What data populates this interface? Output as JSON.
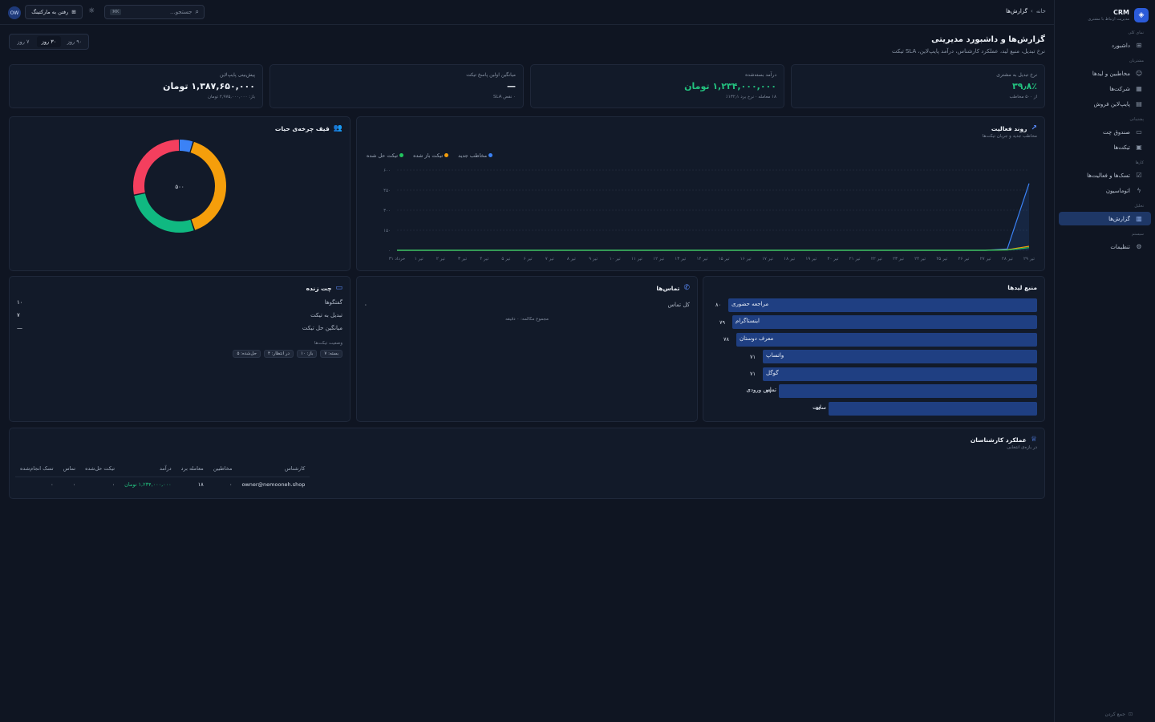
{
  "brand": {
    "title": "CRM",
    "subtitle": "مدیریت ارتباط با مشتری"
  },
  "sidebar": {
    "sections": [
      {
        "label": "نمای کلی",
        "items": [
          {
            "label": "داشبورد",
            "icon": "grid-icon"
          }
        ]
      },
      {
        "label": "مشتریان",
        "items": [
          {
            "label": "مخاطبین و لیدها",
            "icon": "users-icon"
          },
          {
            "label": "شرکت‌ها",
            "icon": "building-icon"
          },
          {
            "label": "پایپ‌لاین فروش",
            "icon": "kanban-icon"
          }
        ]
      },
      {
        "label": "پشتیبانی",
        "items": [
          {
            "label": "صندوق چت",
            "icon": "chat-icon"
          },
          {
            "label": "تیکت‌ها",
            "icon": "ticket-icon"
          }
        ]
      },
      {
        "label": "کارها",
        "items": [
          {
            "label": "تسک‌ها و فعالیت‌ها",
            "icon": "check-square-icon"
          },
          {
            "label": "اتوماسیون",
            "icon": "zap-icon"
          }
        ]
      },
      {
        "label": "تحلیل",
        "items": [
          {
            "label": "گزارش‌ها",
            "icon": "bar-chart-icon",
            "active": true
          }
        ]
      },
      {
        "label": "سیستم",
        "items": [
          {
            "label": "تنظیمات",
            "icon": "gear-icon"
          }
        ]
      }
    ],
    "collapse_label": "جمع کردن"
  },
  "topbar": {
    "breadcrumb_home": "خانه",
    "breadcrumb_current": "گزارش‌ها",
    "search_placeholder": "جستجو...",
    "search_kbd": "K⌘",
    "marketing_button": "رفتن به مارکتینگ",
    "avatar": "OW"
  },
  "page": {
    "title": "گزارش‌ها و داشبورد مدیریتی",
    "subtitle": "نرخ تبدیل، منبع لید، عملکرد کارشناس، درآمد پایپ‌لاین، SLA تیکت",
    "range_options": [
      "۷ روز",
      "۳۰ روز",
      "۹۰ روز"
    ],
    "range_selected": 1
  },
  "kpis": [
    {
      "label": "نرخ تبدیل به مشتری",
      "value": "۳۹٫۸٪",
      "hint": "از ۵۰۰ مخاطب",
      "green": true
    },
    {
      "label": "درآمد بسته‌شده",
      "value": "۱,۲۳۴,۰۰۰,۰۰۰ تومان",
      "hint": "۱۸ معامله · نرخ برد ۱۳۲٫۱٪",
      "green": true
    },
    {
      "label": "میانگین اولین پاسخ تیکت",
      "value": "—",
      "hint": "۰ نقض SLA",
      "green": false
    },
    {
      "label": "پیش‌بینی پایپ‌لاین",
      "value": "۱,۳۸۷,۶۵۰,۰۰۰ تومان",
      "hint": "باز: ۲,۹۷۵,۰۰۰,۰۰۰ تومان",
      "green": false
    }
  ],
  "activity": {
    "title": "روند فعالیت",
    "subtitle": "مخاطب جدید و جریان تیکت‌ها",
    "legend": [
      {
        "label": "مخاطب جدید",
        "color": "#3b82f6"
      },
      {
        "label": "تیکت باز شده",
        "color": "#f59e0b"
      },
      {
        "label": "تیکت حل شده",
        "color": "#22c55e"
      }
    ]
  },
  "chart_data": {
    "type": "line",
    "ylim": [
      0,
      600
    ],
    "yticks": [
      "۰",
      "۱۵۰",
      "۳۰۰",
      "۴۵۰",
      "۶۰۰"
    ],
    "categories": [
      "۳۱ خرداد",
      "۱ تیر",
      "۲ تیر",
      "۳ تیر",
      "۴ تیر",
      "۵ تیر",
      "۶ تیر",
      "۷ تیر",
      "۸ تیر",
      "۹ تیر",
      "۱۰ تیر",
      "۱۱ تیر",
      "۱۲ تیر",
      "۱۳ تیر",
      "۱۴ تیر",
      "۱۵ تیر",
      "۱۶ تیر",
      "۱۷ تیر",
      "۱۸ تیر",
      "۱۹ تیر",
      "۲۰ تیر",
      "۲۱ تیر",
      "۲۲ تیر",
      "۲۳ تیر",
      "۲۴ تیر",
      "۲۵ تیر",
      "۲۶ تیر",
      "۲۷ تیر",
      "۲۸ تیر",
      "۲۹ تیر"
    ],
    "series": [
      {
        "name": "مخاطب جدید",
        "color": "#3b82f6",
        "values": [
          0,
          0,
          0,
          0,
          0,
          0,
          0,
          0,
          0,
          0,
          0,
          0,
          0,
          0,
          0,
          0,
          0,
          0,
          0,
          0,
          0,
          0,
          0,
          0,
          0,
          0,
          0,
          0,
          10,
          500
        ]
      },
      {
        "name": "تیکت باز شده",
        "color": "#f59e0b",
        "values": [
          0,
          0,
          0,
          0,
          0,
          0,
          0,
          0,
          0,
          0,
          0,
          0,
          0,
          0,
          0,
          0,
          0,
          0,
          0,
          0,
          0,
          0,
          0,
          0,
          0,
          0,
          0,
          0,
          4,
          30
        ]
      },
      {
        "name": "تیکت حل شده",
        "color": "#22c55e",
        "values": [
          0,
          0,
          0,
          0,
          0,
          0,
          0,
          0,
          0,
          0,
          0,
          0,
          0,
          0,
          0,
          0,
          0,
          0,
          0,
          0,
          0,
          0,
          0,
          0,
          0,
          0,
          0,
          0,
          2,
          20
        ]
      }
    ]
  },
  "funnel": {
    "title": "قیف چرخه‌ی حیات",
    "center_label": "۵۰۰",
    "segments": [
      {
        "value": 0.05,
        "color": "#3b82f6"
      },
      {
        "value": 0.4,
        "color": "#f59e0b"
      },
      {
        "value": 0.27,
        "color": "#10b981"
      },
      {
        "value": 0.28,
        "color": "#f43f5e"
      }
    ]
  },
  "lead_sources": {
    "title": "منبع لیدها",
    "max": 80,
    "items": [
      {
        "label": "مراجعه حضوری",
        "value": 80,
        "display": "۸۰"
      },
      {
        "label": "اینستاگرام",
        "value": 79,
        "display": "۷۹"
      },
      {
        "label": "معرف دوستان",
        "value": 78,
        "display": "۷۸"
      },
      {
        "label": "واتساپ",
        "value": 71,
        "display": "۷۱"
      },
      {
        "label": "گوگل",
        "value": 71,
        "display": "۷۱"
      },
      {
        "label": "تماس ورودی",
        "value": 67,
        "display": "۶۷"
      },
      {
        "label": "سایت",
        "value": 54,
        "display": "۵۴"
      }
    ]
  },
  "calls": {
    "title": "تماس‌ها",
    "total_label": "کل تماس",
    "total_value": "۰",
    "duration": "مجموع مکالمه: ۰ دقیقه"
  },
  "live_chat": {
    "title": "چت زنده",
    "rows": [
      {
        "label": "گفتگوها",
        "value": "۱۰"
      },
      {
        "label": "تبدیل به تیکت",
        "value": "۷"
      },
      {
        "label": "میانگین حل تیکت",
        "value": "—"
      }
    ],
    "status_title": "وضعیت تیکت‌ها",
    "pills": [
      "بسته: ۷",
      "باز: ۱۰",
      "در انتظار: ۴",
      "حل‌شده: ۵"
    ]
  },
  "performance": {
    "title": "عملکرد کارشناسان",
    "subtitle": "در بازه‌ی انتخابی",
    "columns": [
      "کارشناس",
      "مخاطبین",
      "معامله برد",
      "درآمد",
      "تیکت حل‌شده",
      "تماس",
      "تسک انجام‌شده"
    ],
    "rows": [
      [
        "owner@nemooneh.shop",
        "۰",
        "۱۸",
        "۱,۲۳۴,۰۰۰,۰۰۰ تومان",
        "۰",
        "۰",
        "۰"
      ]
    ]
  }
}
